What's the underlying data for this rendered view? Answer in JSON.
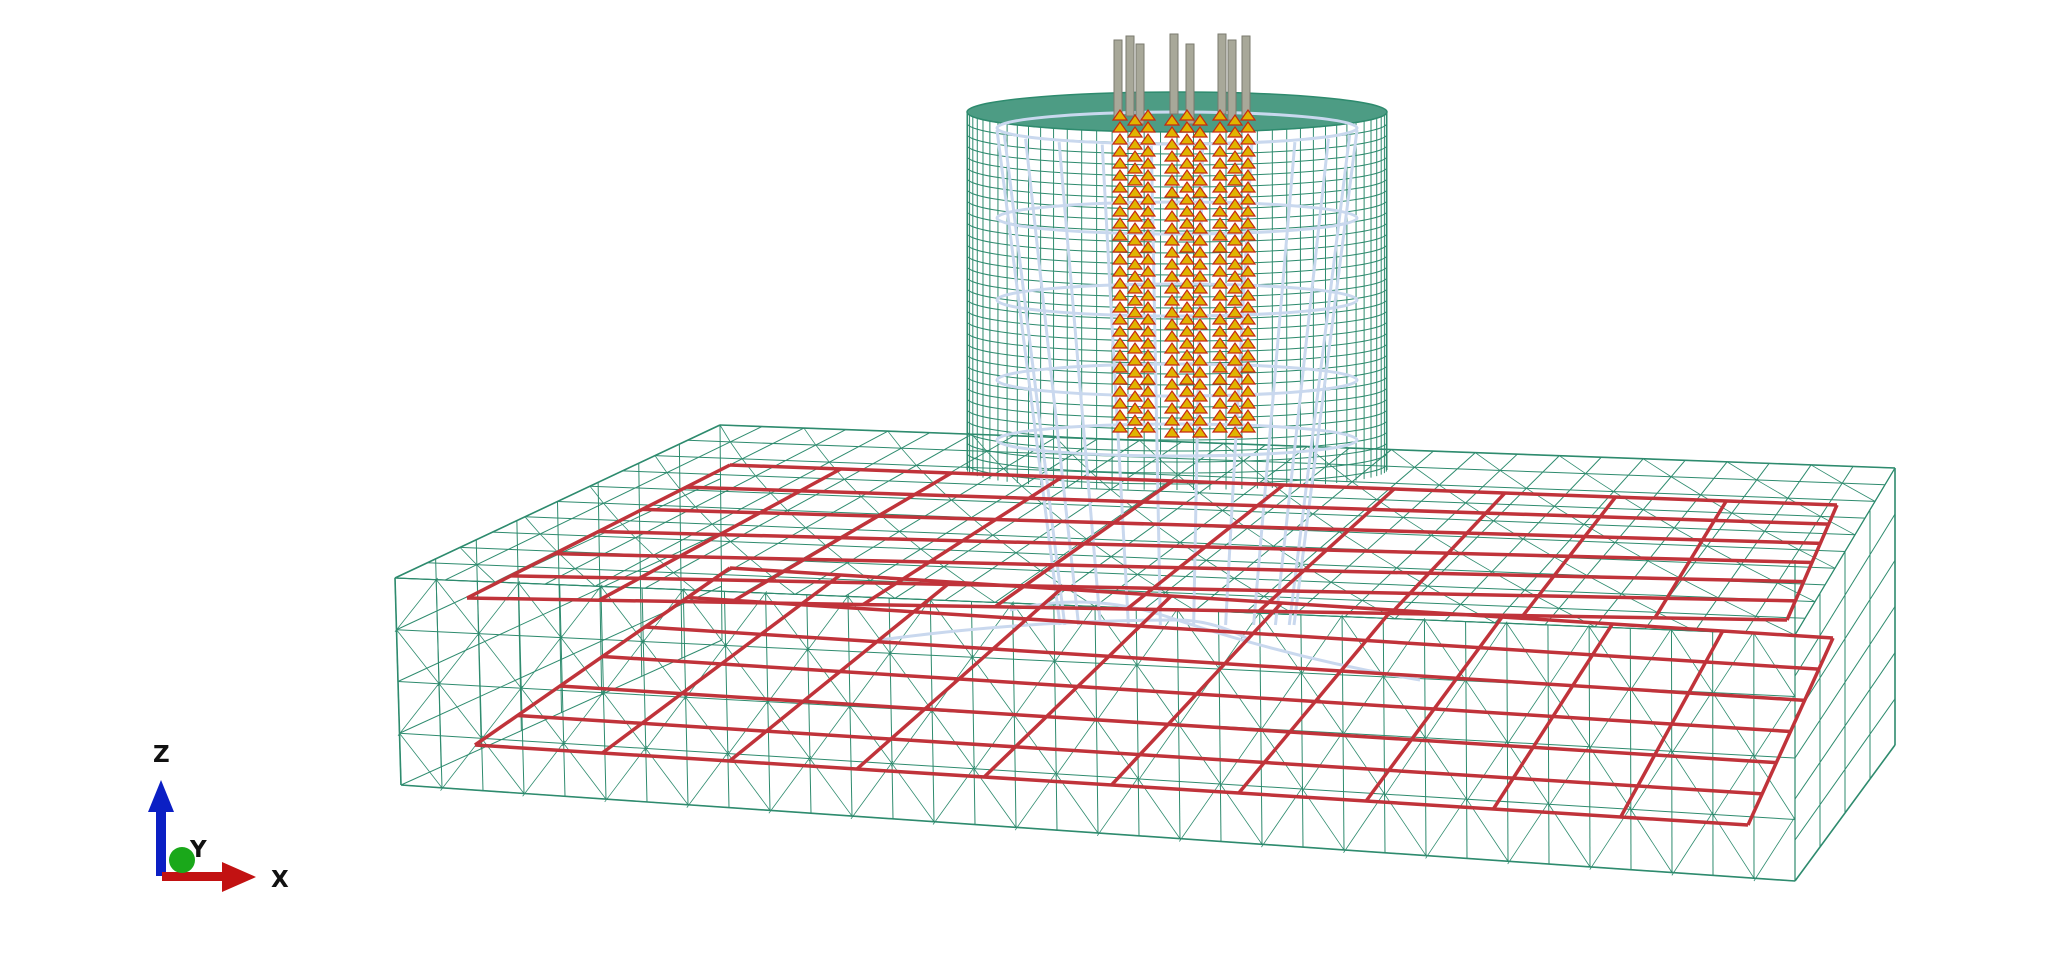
{
  "axes": {
    "z_label": "Z",
    "y_label": "Y",
    "x_label": "X",
    "colors": {
      "z": "#0b1fc4",
      "y": "#1aa81a",
      "x": "#c21212"
    }
  },
  "model": {
    "mesh_color": "#2e8b6e",
    "rebar_color": "#c0333a",
    "cage_color": "#c9d8ee",
    "anchor_color": "#e0b400",
    "anchor_tip_color": "#c62810",
    "bolt_color": "#a8a899"
  }
}
